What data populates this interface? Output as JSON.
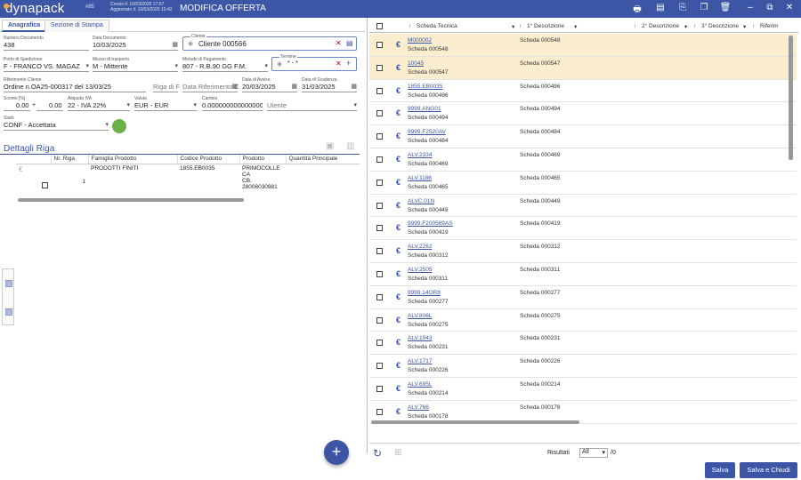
{
  "app": {
    "logo": "dynapack",
    "record_id": "#85",
    "created": "Creato il: 10/03/2025 17:57",
    "updated": "Aggiornato il: 10/03/2025 15:42",
    "title": "MODIFICA OFFERTA"
  },
  "tabs": [
    {
      "label": "Anagrafica"
    },
    {
      "label": "Sezione di Stampa"
    }
  ],
  "form": {
    "numero_documento": {
      "label": "Numero Documento",
      "value": "438"
    },
    "data_documento": {
      "label": "Data Documento",
      "value": "10/03/2025"
    },
    "cliente": {
      "label": "Cliente",
      "value": "Cliente 000566"
    },
    "porto": {
      "label": "Porto di Spedizione",
      "value": "F - FRANCO VS. MAGAZZINO"
    },
    "mezzo": {
      "label": "Mezzo di trasporto",
      "value": "M - Mittente"
    },
    "metodo": {
      "label": "Metodo di Pagamento",
      "value": "807 - R.B.90 GG F.M."
    },
    "termine": {
      "label": "Termine",
      "value": "* - *"
    },
    "riferimento": {
      "label": "Riferimento Cliente",
      "value": "Ordine n.OA25-000317 del 13/03/25"
    },
    "riga": {
      "label": "",
      "value": "Riga di F"
    },
    "data_rif": {
      "label": "",
      "value": "Data Riferimento C"
    },
    "data_avviso": {
      "label": "Data di Avviso",
      "value": "20/03/2025"
    },
    "data_scadenza": {
      "label": "Data di Scadenza",
      "value": "31/03/2025"
    },
    "sconto": {
      "label": "Sconto [%]",
      "value1": "0.00",
      "value2": "0.00"
    },
    "aliquota": {
      "label": "Aliquota IVA",
      "value": "22 - IVA 22%"
    },
    "valuta": {
      "label": "Valuta",
      "value": "EUR - EUR"
    },
    "cambio": {
      "label": "Cambio",
      "value": "0.000000000000000"
    },
    "utente": {
      "label": "",
      "value": "Utente"
    },
    "stato": {
      "label": "Stato",
      "value": "CONF - Accettata"
    }
  },
  "dettagli": {
    "title": "Dettagli Riga",
    "headers": [
      "Nr. Riga",
      "Famiglia Prodotto",
      "Codice Prodotto",
      "Prodotto",
      "Quantità Principale"
    ],
    "row": {
      "nr": "1",
      "famiglia": "PRODOTTI FINITI",
      "codice": "1855.EB0035",
      "prodotto1": "PRIMOCOLLE CA",
      "prodotto2": "CB. 28006030981"
    }
  },
  "right": {
    "headers": [
      "Scheda Tecnica",
      "1° Descrizione",
      "2° Descrizione",
      "3° Descrizione",
      "Riferim"
    ],
    "rows": [
      {
        "code": "M000002",
        "sub": "Scheda 000548",
        "desc": "Scheda 000548",
        "hl": true
      },
      {
        "code": "10045",
        "sub": "Scheda 000547",
        "desc": "Scheda 000547",
        "hl": true
      },
      {
        "code": "1855.EB0035",
        "sub": "Scheda 000496",
        "desc": "Scheda 000496"
      },
      {
        "code": "9999.ANG01",
        "sub": "Scheda 000494",
        "desc": "Scheda 000494"
      },
      {
        "code": "9999.F2520AV",
        "sub": "Scheda 000484",
        "desc": "Scheda 000484"
      },
      {
        "code": "ALV.2334",
        "sub": "Scheda 000469",
        "desc": "Scheda 000469"
      },
      {
        "code": "ALV.1186",
        "sub": "Scheda 000465",
        "desc": "Scheda 000465"
      },
      {
        "code": "ALVC.01N",
        "sub": "Scheda 000449",
        "desc": "Scheda 000449"
      },
      {
        "code": "9999.F200569AS",
        "sub": "Scheda 000419",
        "desc": "Scheda 000419"
      },
      {
        "code": "ALV.2262",
        "sub": "Scheda 000312",
        "desc": "Scheda 000312"
      },
      {
        "code": "ALV.2505",
        "sub": "Scheda 000311",
        "desc": "Scheda 000311"
      },
      {
        "code": "9999.14OR8",
        "sub": "Scheda 000277",
        "desc": "Scheda 000277"
      },
      {
        "code": "ALV.806L",
        "sub": "Scheda 000275",
        "desc": "Scheda 000275"
      },
      {
        "code": "ALV.1943",
        "sub": "Scheda 000231",
        "desc": "Scheda 000231"
      },
      {
        "code": "ALV.1717",
        "sub": "Scheda 000226",
        "desc": "Scheda 000226"
      },
      {
        "code": "ALV.695L",
        "sub": "Scheda 000214",
        "desc": "Scheda 000214"
      },
      {
        "code": "ALV.766",
        "sub": "Scheda 000178",
        "desc": "Scheda 000178"
      }
    ],
    "risultati_label": "Risultati",
    "risultati_value": "All",
    "total": "/0"
  },
  "buttons": {
    "salva": "Salva",
    "salva_chiudi": "Salva e Chiudi"
  },
  "colors": {
    "brand": "#3c55a5",
    "highlight": "#fbeecf",
    "status": "#69b046"
  }
}
